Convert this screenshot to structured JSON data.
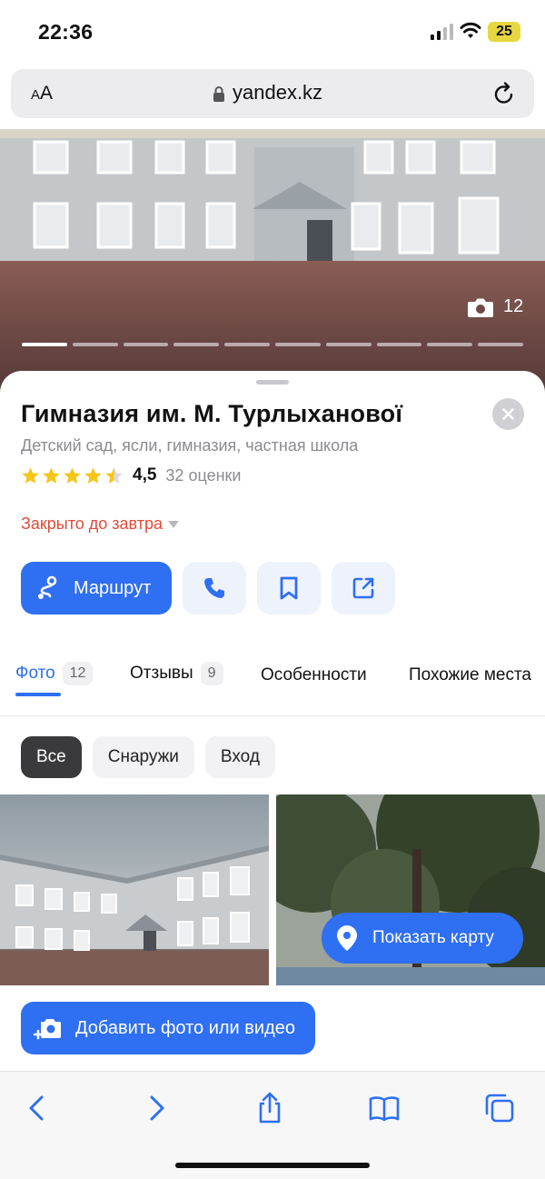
{
  "status_bar": {
    "time": "22:36",
    "battery": "25"
  },
  "browser": {
    "text_size_label_small": "A",
    "text_size_label_large": "A",
    "domain": "yandex.kz"
  },
  "hero": {
    "photo_count": "12"
  },
  "place": {
    "name": "Гимназия им. М. Турлыханової",
    "category": "Детский сад, ясли, гимназия, частная школа",
    "rating": "4,5",
    "rating_value": 4.5,
    "rating_count": "32 оценки",
    "hours_status": "Закрыто до завтра"
  },
  "actions": {
    "route_label": "Маршрут"
  },
  "tabs": [
    {
      "label": "Фото",
      "badge": "12"
    },
    {
      "label": "Отзывы",
      "badge": "9"
    },
    {
      "label": "Особенности"
    },
    {
      "label": "Похожие места"
    }
  ],
  "filters": [
    "Все",
    "Снаружи",
    "Вход"
  ],
  "buttons": {
    "show_map": "Показать карту",
    "add_photo": "Добавить фото или видео"
  },
  "colors": {
    "accent": "#2f6ff2",
    "closed": "#e24a37",
    "star": "#f5c518"
  }
}
